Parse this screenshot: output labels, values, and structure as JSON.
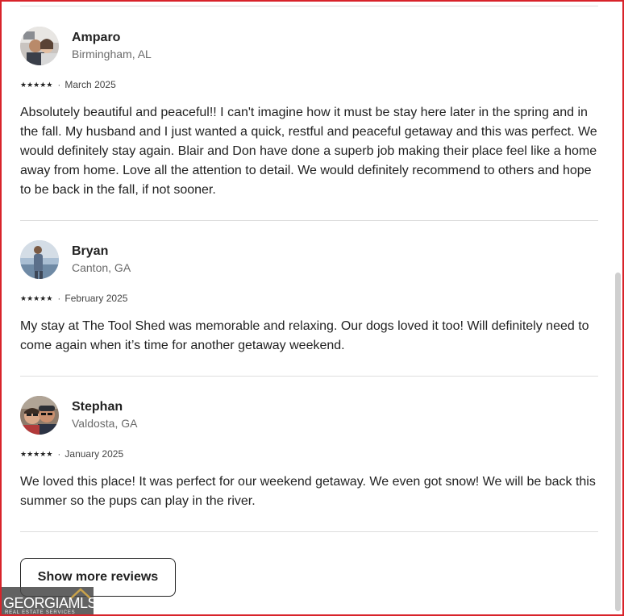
{
  "reviews": [
    {
      "name": "Amparo",
      "location": "Birmingham, AL",
      "rating": 5,
      "date": "March 2025",
      "text": "Absolutely beautiful and peaceful!! I can't imagine how it must be stay here later in the spring and in the fall. My husband and I just wanted a quick, restful and peaceful getaway and this was perfect. We would definitely stay again. Blair and Don have done a superb job making their place feel like a home away from home. Love all the attention to detail. We would definitely recommend to others and hope to be back in the fall, if not sooner."
    },
    {
      "name": "Bryan",
      "location": "Canton, GA",
      "rating": 5,
      "date": "February 2025",
      "text": "My stay at The Tool Shed was memorable and relaxing. Our dogs loved it too! Will definitely need to come again when it’s time for another getaway weekend."
    },
    {
      "name": "Stephan",
      "location": "Valdosta, GA",
      "rating": 5,
      "date": "January 2025",
      "text": "We loved this place! It was perfect for our weekend getaway. We even got snow! We will be back this summer so the pups can play in the river."
    }
  ],
  "meta_separator": "·",
  "show_more_label": "Show more reviews",
  "watermark": {
    "main": "GEORGIAMLS",
    "sub": "REAL ESTATE SERVICES"
  },
  "icons": {
    "star": "star-icon",
    "avatar": "avatar-photo"
  },
  "colors": {
    "border": "#d8232a",
    "text": "#222222",
    "muted": "#6a6a6a",
    "divider": "#dddddd"
  }
}
